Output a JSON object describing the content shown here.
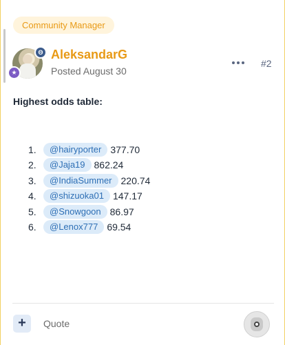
{
  "post": {
    "role_badge": "Community Manager",
    "author": "AleksandarG",
    "posted": "Posted August 30",
    "post_number": "#2",
    "moderator_badge_glyph": "Θ",
    "rank_badge_glyph": "★",
    "heading": "Highest odds table:",
    "odds": [
      {
        "rank": "1.",
        "user": "@hairyporter",
        "value": "377.70"
      },
      {
        "rank": "2.",
        "user": "@Jaja19",
        "value": "862.24"
      },
      {
        "rank": "3.",
        "user": "@IndiaSummer",
        "value": "220.74"
      },
      {
        "rank": "4.",
        "user": "@shizuoka01",
        "value": "147.17"
      },
      {
        "rank": "5.",
        "user": "@Snowgoon",
        "value": "86.97"
      },
      {
        "rank": "6.",
        "user": "@Lenox777",
        "value": "69.54"
      }
    ]
  },
  "footer": {
    "plus_label": "+",
    "quote_label": "Quote"
  },
  "colors": {
    "accent": "#e89a16",
    "mention_bg": "#dcebf9",
    "mention_text": "#2e6fb5"
  },
  "icons": {
    "more": "more-horizontal-icon",
    "bot": "bot-avatar-icon"
  }
}
